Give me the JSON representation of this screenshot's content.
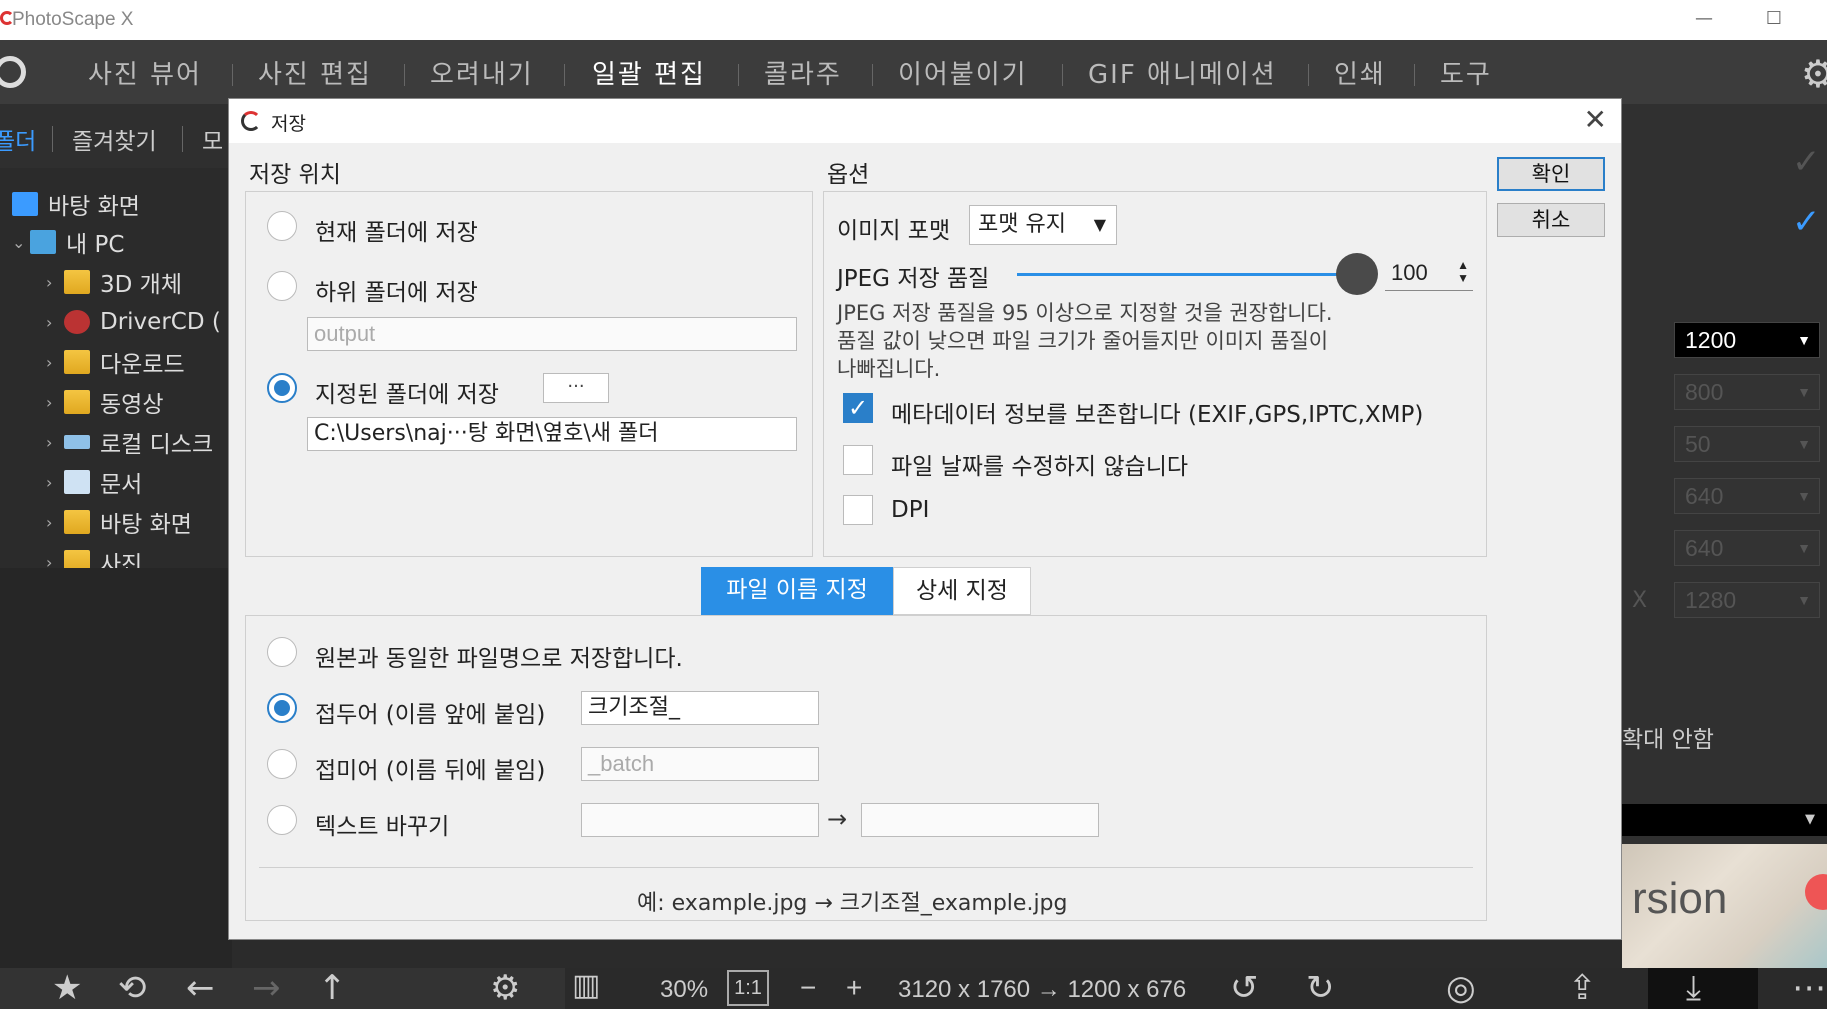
{
  "window": {
    "title": "PhotoScape X",
    "minimize_glyph": "—",
    "maximize_glyph": "☐"
  },
  "menu": {
    "items": [
      "사진 뷰어",
      "사진 편집",
      "오려내기",
      "일괄 편집",
      "콜라주",
      "이어붙이기",
      "GIF 애니메이션",
      "인쇄",
      "도구"
    ],
    "active": "일괄 편집"
  },
  "left_panel": {
    "tabs": [
      "폴더",
      "즐겨찾기",
      "모"
    ],
    "tree": [
      {
        "label": "바탕 화면",
        "icon": "desktop-folder-icon"
      },
      {
        "label": "내 PC",
        "icon": "pc-icon"
      },
      {
        "label": "3D 개체",
        "icon": "folder-icon"
      },
      {
        "label": "DriverCD (",
        "icon": "cd-icon"
      },
      {
        "label": "다운로드",
        "icon": "download-folder-icon"
      },
      {
        "label": "동영상",
        "icon": "video-folder-icon"
      },
      {
        "label": "로컬 디스크",
        "icon": "drive-icon"
      },
      {
        "label": "문서",
        "icon": "document-folder-icon"
      },
      {
        "label": "바탕 화면",
        "icon": "folder-icon"
      },
      {
        "label": "사진",
        "icon": "folder-icon"
      }
    ]
  },
  "right_panel": {
    "sizes": [
      {
        "value": "1200",
        "enabled": true
      },
      {
        "value": "800",
        "enabled": false
      },
      {
        "value": "50",
        "enabled": false
      },
      {
        "value": "640",
        "enabled": false
      },
      {
        "value": "640",
        "enabled": false
      },
      {
        "value": "1280",
        "enabled": false
      }
    ],
    "x_label": "X",
    "no_zoom_text": "확대 안함",
    "preview_text": "rsion"
  },
  "bottom": {
    "zoom": "30%",
    "one_to_one": "1:1",
    "minus": "−",
    "plus": "+",
    "size_info": "3120 x 1760 → 1200 x 676"
  },
  "dialog": {
    "title": "저장",
    "close_glyph": "✕",
    "ok_label": "확인",
    "cancel_label": "취소",
    "location": {
      "section_label": "저장 위치",
      "options": [
        {
          "label": "현재 폴더에 저장",
          "checked": false
        },
        {
          "label": "하위 폴더에 저장",
          "checked": false
        },
        {
          "label": "지정된 폴더에 저장",
          "checked": true
        }
      ],
      "subfolder_placeholder": "output",
      "browse_label": "···",
      "folder_path": "C:\\Users\\naj···탕 화면\\옆호\\새 폴더"
    },
    "options": {
      "section_label": "옵션",
      "format_label": "이미지 포맷",
      "format_value": "포맷 유지",
      "jpeg_quality_label": "JPEG 저장 품질",
      "jpeg_quality_value": "100",
      "jpeg_quality_fraction": 1.0,
      "hint": "JPEG 저장 품질을 95 이상으로 지정할 것을 권장합니다.\n품질 값이 낮으면 파일 크기가 줄어들지만 이미지 품질이\n나빠집니다.",
      "checkboxes": [
        {
          "label": "메타데이터 정보를 보존합니다 (EXIF,GPS,IPTC,XMP)",
          "checked": true
        },
        {
          "label": "파일 날짜를 수정하지 않습니다",
          "checked": false
        },
        {
          "label": "DPI",
          "checked": false
        }
      ]
    },
    "tabs": [
      {
        "label": "파일 이름 지정",
        "active": true
      },
      {
        "label": "상세 지정",
        "active": false
      }
    ],
    "naming": {
      "options": [
        {
          "label": "원본과 동일한 파일명으로 저장합니다.",
          "checked": false
        },
        {
          "label": "접두어 (이름 앞에 붙임)",
          "checked": true
        },
        {
          "label": "접미어 (이름 뒤에 붙임)",
          "checked": false
        },
        {
          "label": "텍스트 바꾸기",
          "checked": false
        }
      ],
      "prefix_value": "크기조절_",
      "suffix_placeholder": "_batch",
      "replace_from": "",
      "replace_to": "",
      "replace_arrow": "→",
      "example": "예: example.jpg → 크기조절_example.jpg"
    }
  }
}
